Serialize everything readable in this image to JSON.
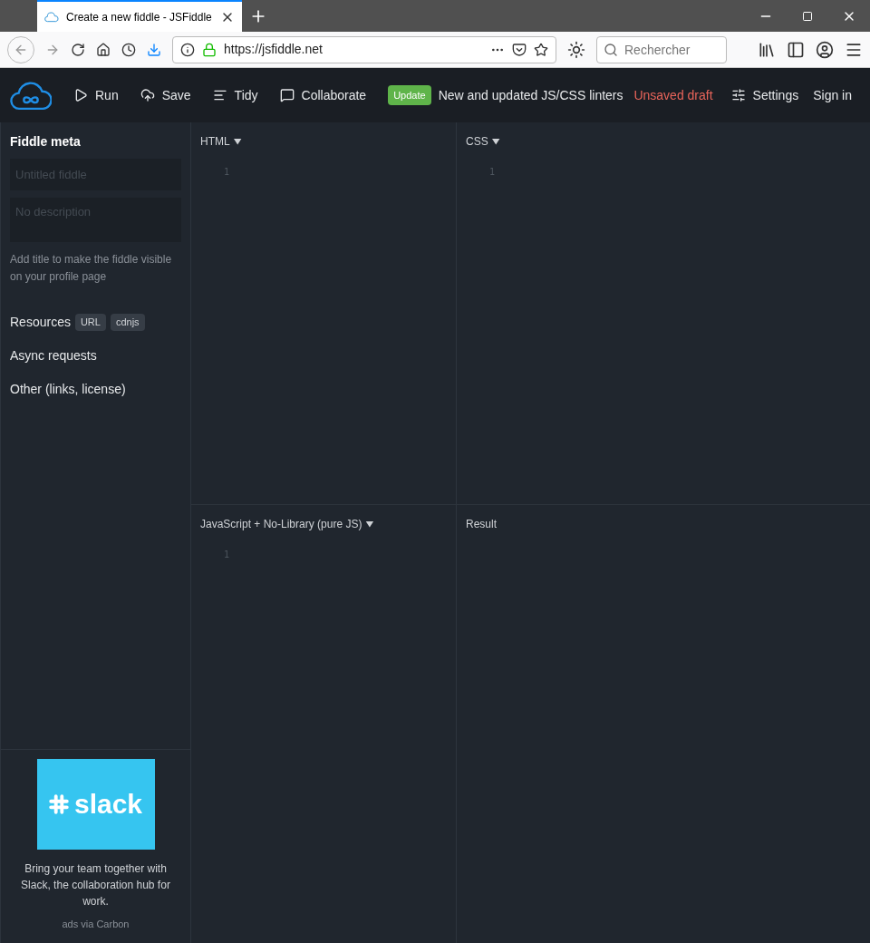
{
  "browser": {
    "tab_title": "Create a new fiddle - JSFiddle",
    "url": "https://jsfiddle.net",
    "search_placeholder": "Rechercher"
  },
  "toolbar": {
    "actions": [
      {
        "label": "Run",
        "kind": "run"
      },
      {
        "label": "Save",
        "kind": "save"
      },
      {
        "label": "Tidy",
        "kind": "tidy"
      },
      {
        "label": "Collaborate",
        "kind": "collaborate"
      }
    ],
    "update_badge": "Update",
    "announcement": "New and updated JS/CSS linters",
    "draft_status": "Unsaved draft",
    "settings": "Settings",
    "sign_in": "Sign in"
  },
  "sidebar": {
    "title": "Fiddle meta",
    "title_placeholder": "Untitled fiddle",
    "description_placeholder": "No description",
    "hint": "Add title to make the fiddle visible on your profile page",
    "sections": [
      {
        "label": "Resources",
        "tags": [
          "URL",
          "cdnjs"
        ]
      },
      {
        "label": "Async requests"
      },
      {
        "label": "Other (links, license)"
      }
    ],
    "ad": {
      "logo_text": "slack",
      "text": "Bring your team together with Slack, the collaboration hub for work.",
      "credit": "ads via Carbon"
    }
  },
  "panels": [
    {
      "title": "HTML",
      "dropdown": true,
      "line_numbers": [
        "1"
      ]
    },
    {
      "title": "CSS",
      "dropdown": true,
      "line_numbers": [
        "1"
      ]
    },
    {
      "title": "JavaScript + No-Library (pure JS)",
      "dropdown": true,
      "line_numbers": [
        "1"
      ]
    },
    {
      "title": "Result",
      "dropdown": false
    }
  ]
}
